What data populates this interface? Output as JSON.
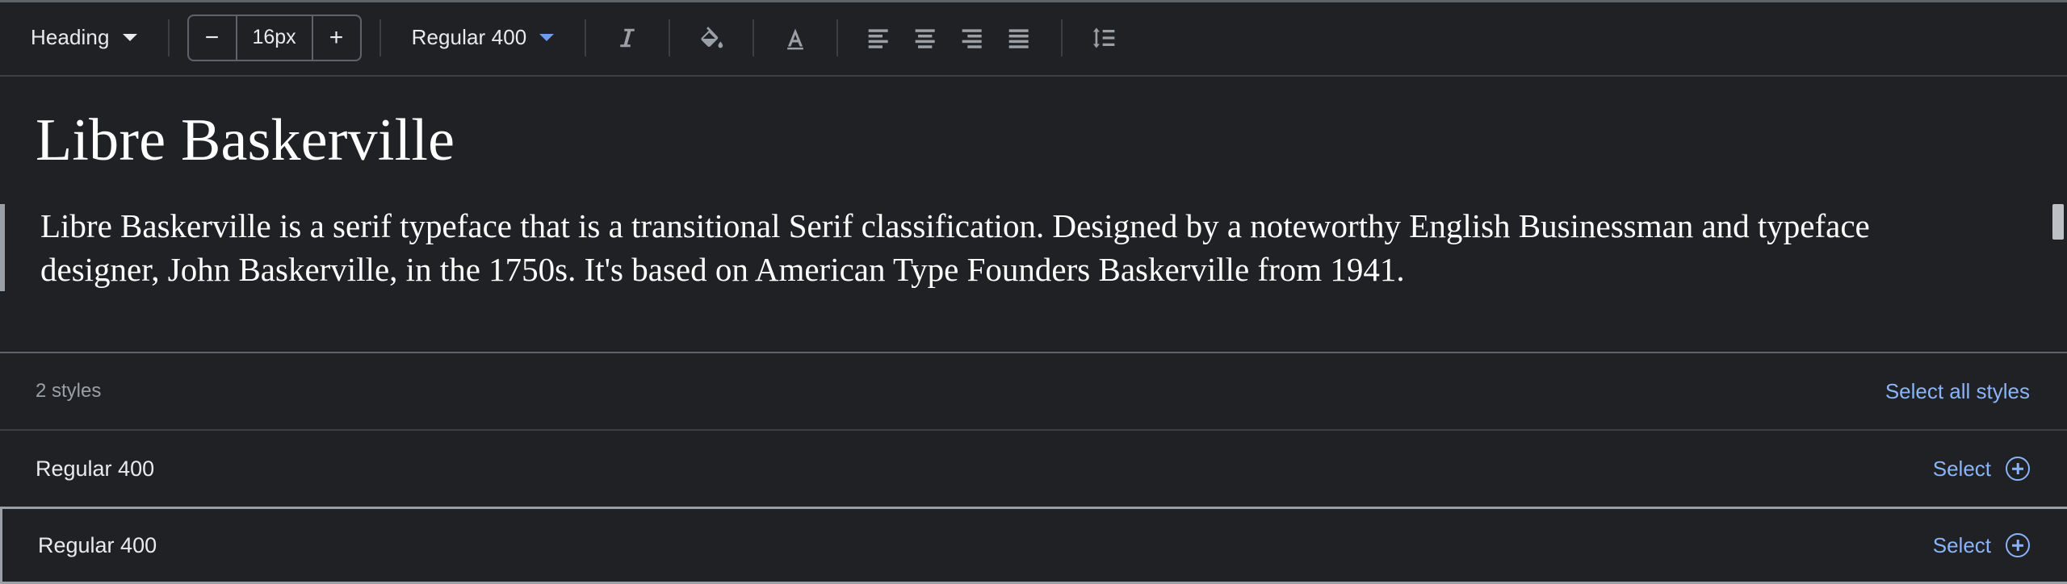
{
  "toolbar": {
    "block_style": {
      "label": "Heading",
      "icon": "chevron-down-icon"
    },
    "font_size": {
      "decrease": "−",
      "value": "16px",
      "increase": "+"
    },
    "font_weight": {
      "label": "Regular 400",
      "icon": "chevron-down-icon"
    },
    "buttons": [
      {
        "name": "italic",
        "icon": "italic-icon",
        "title": "Italic"
      },
      {
        "name": "highlight",
        "icon": "paint-bucket-icon",
        "title": "Highlight color"
      },
      {
        "name": "text-color",
        "icon": "text-color-icon",
        "title": "Text color"
      },
      {
        "name": "align-left",
        "icon": "align-left-icon",
        "title": "Align left"
      },
      {
        "name": "align-center",
        "icon": "align-center-icon",
        "title": "Align center"
      },
      {
        "name": "align-right",
        "icon": "align-right-icon",
        "title": "Align right"
      },
      {
        "name": "align-justify",
        "icon": "align-justify-icon",
        "title": "Justify"
      },
      {
        "name": "line-height",
        "icon": "line-height-icon",
        "title": "Line height"
      }
    ]
  },
  "specimen": {
    "heading": "Libre Baskerville",
    "paragraph": "Libre Baskerville is a serif typeface that is a transitional Serif classification.  Designed by a noteworthy English Businessman and typeface designer, John Baskerville, in the 1750s. It's based on American Type Founders Baskerville from 1941."
  },
  "styles": {
    "count_label": "2 styles",
    "select_all_label": "Select all styles",
    "rows": [
      {
        "name": "Regular 400",
        "action": "Select",
        "selected": false
      },
      {
        "name": "Regular 400",
        "action": "Select",
        "selected": true
      }
    ]
  },
  "colors": {
    "background": "#202124",
    "accent_blue": "#8ab4f8",
    "text_primary": "#e8eaed",
    "text_muted": "#9aa0a6",
    "divider": "#3c4043"
  }
}
